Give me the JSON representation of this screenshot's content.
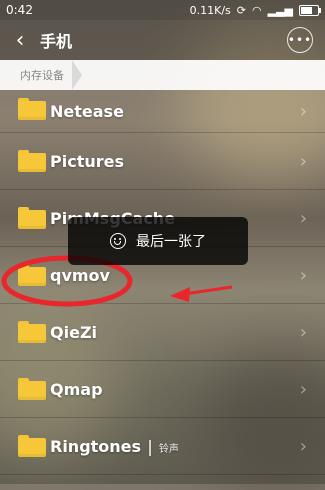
{
  "status_bar": {
    "time": "0:42",
    "speed": "0.11K/s"
  },
  "header": {
    "title": "手机",
    "back_icon": "chevron-left-icon",
    "more_icon": "more-icon"
  },
  "breadcrumb": {
    "label": "内存设备"
  },
  "folders": [
    {
      "name": "Netease"
    },
    {
      "name": "Pictures"
    },
    {
      "name": "PimMsgCache"
    },
    {
      "name": "qvmov"
    },
    {
      "name": "QieZi"
    },
    {
      "name": "Qmap"
    },
    {
      "name": "Ringtones",
      "tag": "铃声"
    }
  ],
  "toast": {
    "text": "最后一张了",
    "icon": "smile-icon"
  },
  "annotation": {
    "color": "#e8262b"
  },
  "colors": {
    "folder": "#f6c839"
  }
}
